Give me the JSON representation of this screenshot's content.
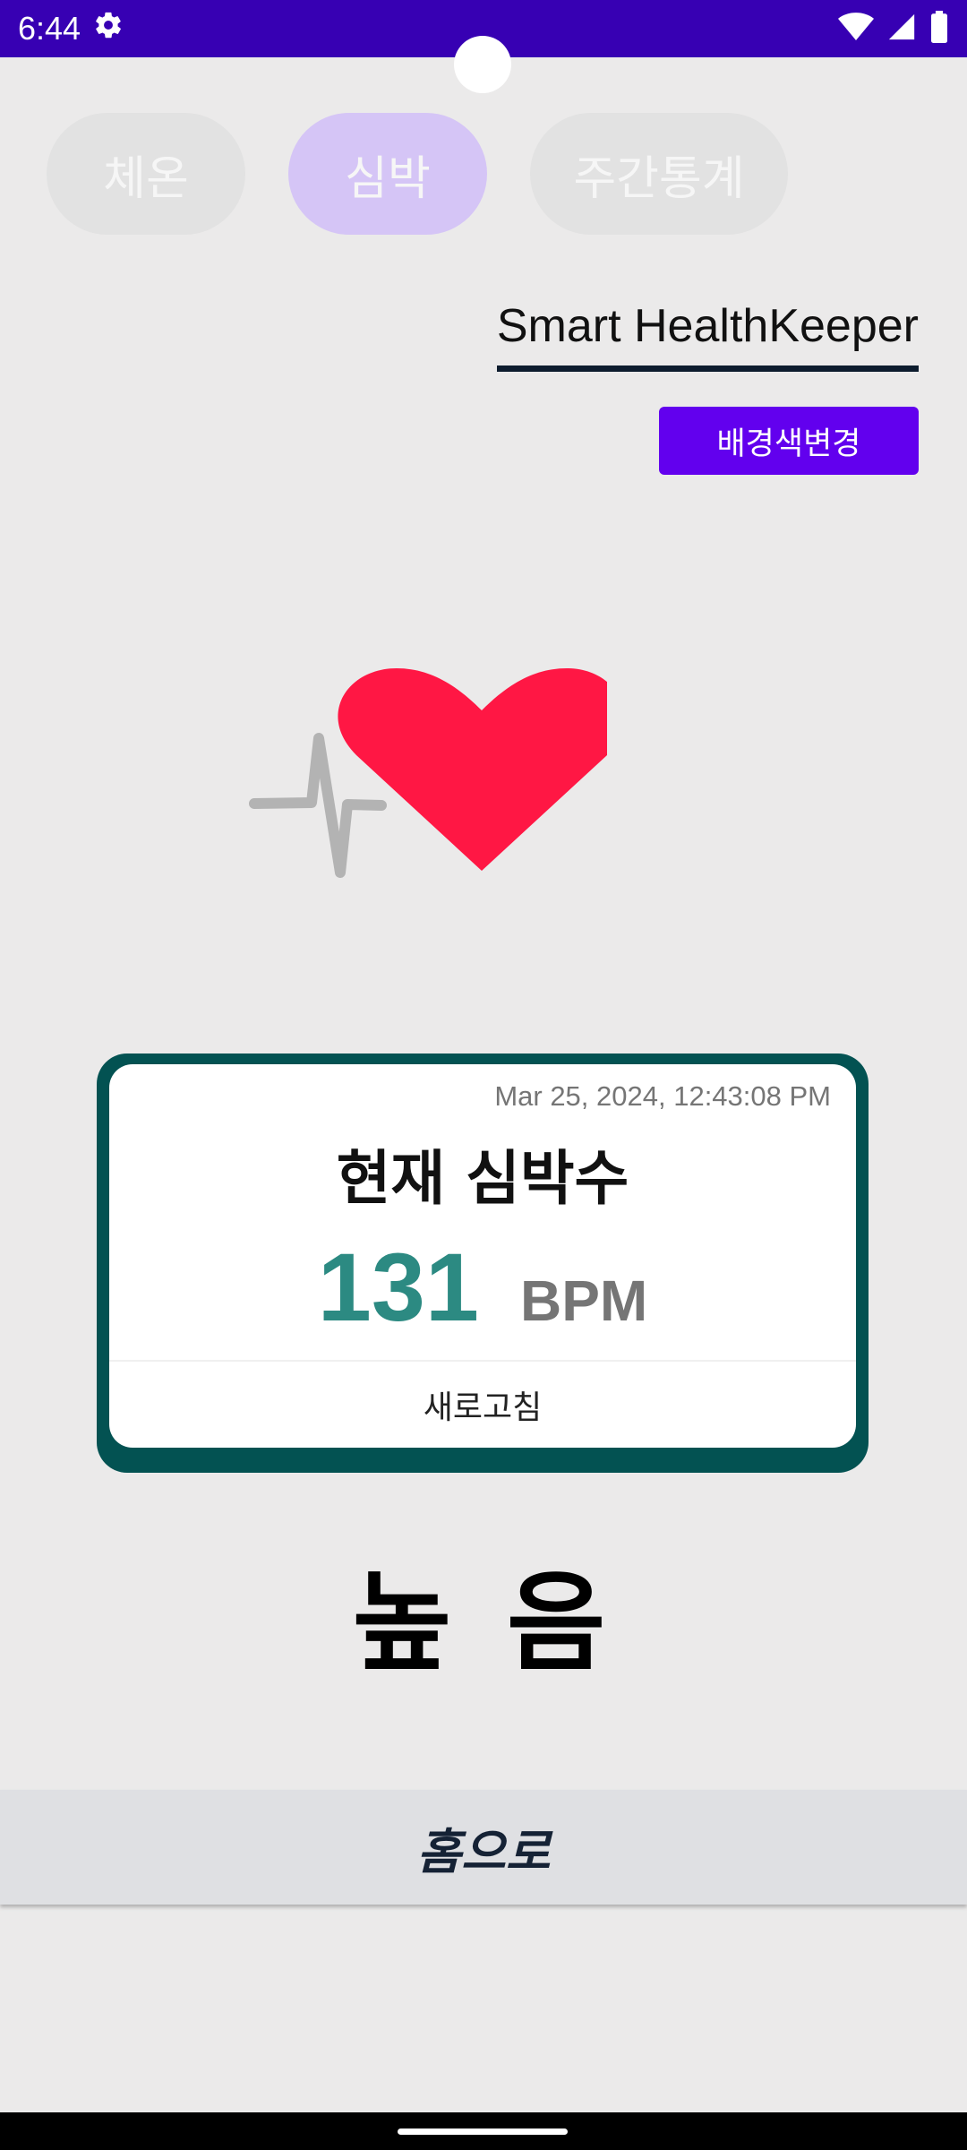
{
  "status_bar": {
    "time": "6:44",
    "icons": [
      "gear-icon",
      "wifi-icon",
      "signal-icon",
      "battery-icon"
    ]
  },
  "tabs": [
    {
      "label": "체온",
      "selected": false
    },
    {
      "label": "심박",
      "selected": true
    },
    {
      "label": "주간통계",
      "selected": false
    }
  ],
  "header": {
    "app_title": "Smart HealthKeeper",
    "bg_button_label": "배경색변경"
  },
  "illustration": {
    "icon": "heartbeat-icon",
    "heart_color": "#ff1744",
    "pulse_color": "#b3b3b3"
  },
  "card": {
    "timestamp": "Mar 25, 2024, 12:43:08 PM",
    "title": "현재 심박수",
    "value": "131",
    "unit": "BPM",
    "refresh_label": "새로고침",
    "border_color": "#035252",
    "value_color": "#2c8a82"
  },
  "level": "높 음",
  "home_button_label": "홈으로",
  "colors": {
    "status_bar": "#3700b3",
    "accent": "#6200ee",
    "selected_tab": "#d5c5f6",
    "background": "#ebeaea"
  }
}
